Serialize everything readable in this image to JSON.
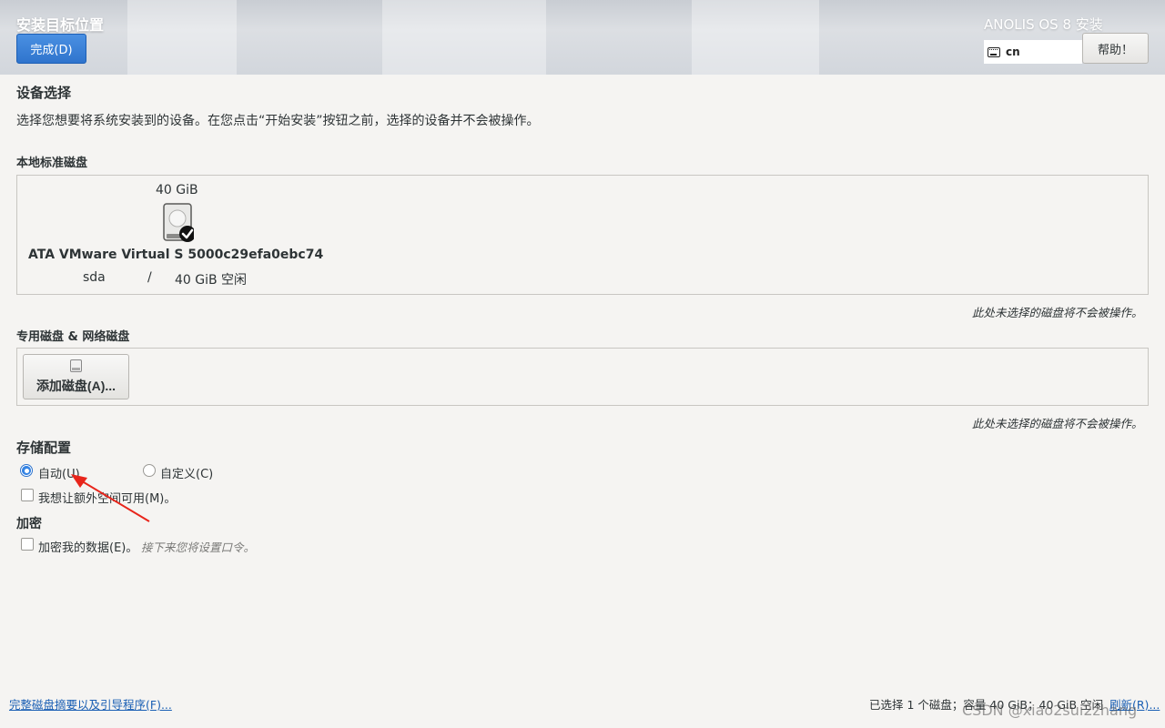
{
  "header": {
    "title": "安装目标位置",
    "done_label": "完成(D)",
    "product_title": "ANOLIS OS 8 安装",
    "keyboard_layout": "cn",
    "help_label": "帮助！"
  },
  "device_selection": {
    "title": "设备选择",
    "description": "选择您想要将系统安装到的设备。在您点击“开始安装”按钮之前，选择的设备并不会被操作。"
  },
  "local_disks": {
    "title": "本地标准磁盘",
    "disks": [
      {
        "size": "40 GiB",
        "name": "ATA VMware Virtual S 5000c29efa0ebc74",
        "device": "sda",
        "separator": "/",
        "free": "40 GiB 空闲",
        "selected": true
      }
    ],
    "note": "此处未选择的磁盘将不会被操作。"
  },
  "specialized_disks": {
    "title": "专用磁盘 & 网络磁盘",
    "add_disk_label": "添加磁盘(A)...",
    "note": "此处未选择的磁盘将不会被操作。"
  },
  "storage_config": {
    "title": "存储配置",
    "options": [
      {
        "label": "自动(U)",
        "selected": true
      },
      {
        "label": "自定义(C)",
        "selected": false
      }
    ],
    "extra_space_label": "我想让额外空间可用(M)。",
    "extra_space_checked": false
  },
  "encryption": {
    "title": "加密",
    "encrypt_label": "加密我的数据(E)。",
    "encrypt_checked": false,
    "hint": "接下来您将设置口令。"
  },
  "footer": {
    "summary_link": "完整磁盘摘要以及引导程序(F)...",
    "selection_summary": "已选择 1 个磁盘；容量 40 GiB；40 GiB 空闲",
    "refresh_link": "刷新(R)..."
  },
  "watermark": "CSDN @xiao2sui2zhang",
  "colors": {
    "accent": "#3584e4",
    "link": "#1a5fb4",
    "annotation_arrow": "#e8251b",
    "background": "#f5f4f2"
  }
}
